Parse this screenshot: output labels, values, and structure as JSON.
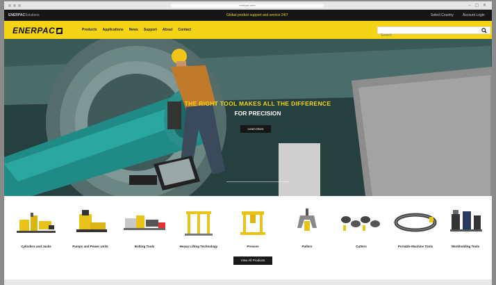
{
  "browser": {
    "url": "enerpac.com"
  },
  "utility_bar": {
    "left_links": [
      "ENERPAC",
      "Solutions"
    ],
    "promo_text": "Global product support and service 24/7",
    "right_links": [
      "Select Country",
      "Account Login"
    ]
  },
  "nav": {
    "logo_text": "ENERPAC",
    "items": [
      "Products",
      "Applications",
      "News",
      "Support",
      "About",
      "Contact"
    ],
    "search_placeholder": "Search"
  },
  "hero": {
    "headline": "THE RIGHT TOOL MAKES ALL THE DIFFERENCE",
    "subhead": "FOR PRECISION",
    "cta_label": "Learn More"
  },
  "categories": [
    {
      "label": "Cylinders and Jacks",
      "icon": "cylinders-icon"
    },
    {
      "label": "Pumps and Power Units",
      "icon": "pumps-icon"
    },
    {
      "label": "Bolting Tools",
      "icon": "bolting-tools-icon"
    },
    {
      "label": "Heavy Lifting Technology",
      "icon": "heavy-lifting-icon"
    },
    {
      "label": "Presses",
      "icon": "presses-icon"
    },
    {
      "label": "Pullers",
      "icon": "pullers-icon"
    },
    {
      "label": "Cutters",
      "icon": "cutters-icon"
    },
    {
      "label": "Portable Machine Tools",
      "icon": "machine-tools-icon"
    },
    {
      "label": "Workholding Tools",
      "icon": "workholding-icon"
    }
  ],
  "view_all_label": "View All Products",
  "colors": {
    "brand_yellow": "#f5d417",
    "dark": "#161616",
    "hero_teal": "#2f6b68"
  }
}
